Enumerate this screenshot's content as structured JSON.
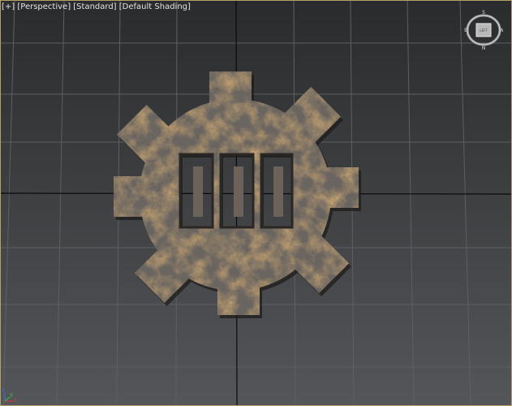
{
  "viewport": {
    "labels": [
      "[+]",
      "[Perspective]",
      "[Standard]",
      "[Default Shading]"
    ],
    "border_color": "#b5a06a",
    "grid_color": "#5e5f62",
    "axis_line_color": "#0a0a0a"
  },
  "viewcube": {
    "compass": {
      "north": "N",
      "south": "S",
      "east": "E",
      "west": "W"
    },
    "face_label": "LEFT"
  },
  "axis_tripod": {
    "x": "x",
    "y": "y",
    "z": "z"
  },
  "object": {
    "type": "rusty gear with three slots",
    "colors": {
      "rust": "#7a4a22",
      "rust_light": "#b87a32",
      "metal": "#6a6a6a",
      "shadow": "#2b2b2b"
    }
  }
}
